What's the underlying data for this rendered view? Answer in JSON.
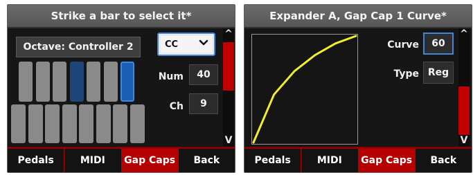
{
  "left_panel": {
    "title": "Strike a bar to select it*",
    "octave_label": "Octave: Controller 2",
    "message_type": {
      "selected": "CC"
    },
    "num": {
      "label": "Num",
      "value": "40"
    },
    "ch": {
      "label": "Ch",
      "value": "9"
    },
    "scroll": {
      "up": "^",
      "down": "V"
    },
    "keyboard": {
      "upper_keys": [
        "normal",
        "normal",
        "normal",
        "dark",
        "normal",
        "normal",
        "selected"
      ],
      "lower_key_count": 8
    },
    "tabs": [
      {
        "label": "Pedals",
        "active": false
      },
      {
        "label": "MIDI",
        "active": false
      },
      {
        "label": "Gap Caps",
        "active": true
      },
      {
        "label": "Back",
        "active": false
      }
    ]
  },
  "right_panel": {
    "title": "Expander A, Gap Cap 1 Curve*",
    "curve": {
      "label": "Curve",
      "value": "60"
    },
    "type": {
      "label": "Type",
      "value": "Reg"
    },
    "scroll": {
      "up": "^",
      "down": "V"
    },
    "graph": {
      "line_color": "#f2ee2a",
      "curve_points": [
        [
          0,
          0
        ],
        [
          0.2,
          0.45
        ],
        [
          0.4,
          0.67
        ],
        [
          0.6,
          0.82
        ],
        [
          0.8,
          0.93
        ],
        [
          1.0,
          1.0
        ]
      ]
    },
    "tabs": [
      {
        "label": "Pedals",
        "active": false
      },
      {
        "label": "MIDI",
        "active": false
      },
      {
        "label": "Gap Caps",
        "active": true
      },
      {
        "label": "Back",
        "active": false
      }
    ]
  },
  "colors": {
    "accent_red": "#c00000",
    "focus_blue": "#3f86d6",
    "selected_key_blue": "#1a5fb6"
  }
}
